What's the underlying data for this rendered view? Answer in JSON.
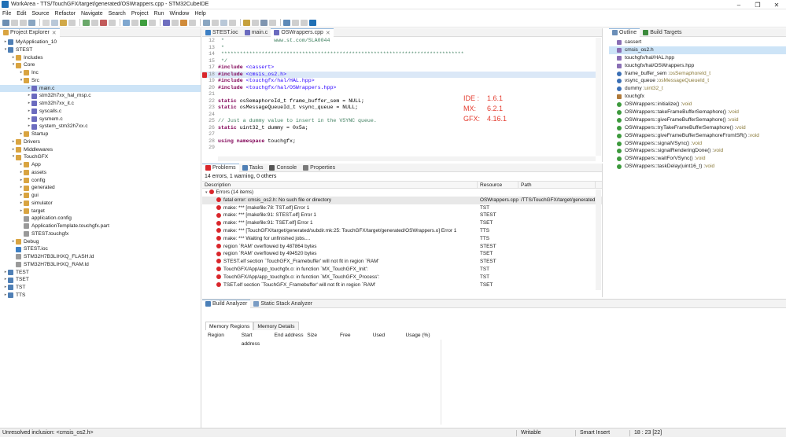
{
  "window": {
    "title": "WorkArea - TTS/TouchGFX/target/generated/OSWrappers.cpp - STM32CubeIDE"
  },
  "menu": [
    "File",
    "Edit",
    "Source",
    "Refactor",
    "Navigate",
    "Search",
    "Project",
    "Run",
    "Window",
    "Help"
  ],
  "explorer": {
    "tab": "Project Explorer",
    "tree": [
      {
        "label": "MyApplication_10",
        "depth": 0,
        "arrow": "▸",
        "icon": "project"
      },
      {
        "label": "STEST",
        "depth": 0,
        "arrow": "▾",
        "icon": "project"
      },
      {
        "label": "Includes",
        "depth": 1,
        "arrow": "▸",
        "icon": "folder"
      },
      {
        "label": "Core",
        "depth": 1,
        "arrow": "▾",
        "icon": "folder"
      },
      {
        "label": "Inc",
        "depth": 2,
        "arrow": "▸",
        "icon": "folder"
      },
      {
        "label": "Src",
        "depth": 2,
        "arrow": "▾",
        "icon": "folder"
      },
      {
        "label": "main.c",
        "depth": 3,
        "arrow": "▸",
        "icon": "cfile",
        "selected": true
      },
      {
        "label": "stm32h7xx_hal_msp.c",
        "depth": 3,
        "arrow": "▸",
        "icon": "cfile"
      },
      {
        "label": "stm32h7xx_it.c",
        "depth": 3,
        "arrow": "▸",
        "icon": "cfile"
      },
      {
        "label": "syscalls.c",
        "depth": 3,
        "arrow": "▸",
        "icon": "cfile"
      },
      {
        "label": "sysmem.c",
        "depth": 3,
        "arrow": "▸",
        "icon": "cfile"
      },
      {
        "label": "system_stm32h7xx.c",
        "depth": 3,
        "arrow": "▸",
        "icon": "cfile"
      },
      {
        "label": "Startup",
        "depth": 2,
        "arrow": "▸",
        "icon": "folder"
      },
      {
        "label": "Drivers",
        "depth": 1,
        "arrow": "▸",
        "icon": "folder"
      },
      {
        "label": "Middlewares",
        "depth": 1,
        "arrow": "▸",
        "icon": "folder"
      },
      {
        "label": "TouchGFX",
        "depth": 1,
        "arrow": "▾",
        "icon": "folder"
      },
      {
        "label": "App",
        "depth": 2,
        "arrow": "▸",
        "icon": "folder"
      },
      {
        "label": "assets",
        "depth": 2,
        "arrow": "▸",
        "icon": "folder"
      },
      {
        "label": "config",
        "depth": 2,
        "arrow": "▸",
        "icon": "folder"
      },
      {
        "label": "generated",
        "depth": 2,
        "arrow": "▸",
        "icon": "folder"
      },
      {
        "label": "gui",
        "depth": 2,
        "arrow": "▸",
        "icon": "folder"
      },
      {
        "label": "simulator",
        "depth": 2,
        "arrow": "▸",
        "icon": "folder"
      },
      {
        "label": "target",
        "depth": 2,
        "arrow": "▸",
        "icon": "folder"
      },
      {
        "label": "application.config",
        "depth": 2,
        "arrow": "",
        "icon": "file"
      },
      {
        "label": "ApplicationTemplate.touchgfx.part",
        "depth": 2,
        "arrow": "",
        "icon": "file"
      },
      {
        "label": "STEST.touchgfx",
        "depth": 2,
        "arrow": "",
        "icon": "file"
      },
      {
        "label": "Debug",
        "depth": 1,
        "arrow": "▸",
        "icon": "folder"
      },
      {
        "label": "STEST.ioc",
        "depth": 1,
        "arrow": "",
        "icon": "ioc"
      },
      {
        "label": "STM32H7B3LIHXQ_FLASH.ld",
        "depth": 1,
        "arrow": "",
        "icon": "file"
      },
      {
        "label": "STM32H7B3LIHXQ_RAM.ld",
        "depth": 1,
        "arrow": "",
        "icon": "file"
      },
      {
        "label": "TEST",
        "depth": 0,
        "arrow": "▸",
        "icon": "project"
      },
      {
        "label": "TSET",
        "depth": 0,
        "arrow": "▸",
        "icon": "project"
      },
      {
        "label": "TST",
        "depth": 0,
        "arrow": "▸",
        "icon": "project"
      },
      {
        "label": "TTS",
        "depth": 0,
        "arrow": "▸",
        "icon": "project"
      }
    ]
  },
  "editor": {
    "tabs": [
      {
        "label": "STEST.ioc",
        "active": false
      },
      {
        "label": "main.c",
        "active": false
      },
      {
        "label": "OSWrappers.cpp",
        "active": true
      }
    ],
    "lines": [
      {
        "n": "12",
        "parts": [
          {
            "t": " *                www.st.com/SLA0044",
            "c": "cm"
          }
        ]
      },
      {
        "n": "13",
        "parts": [
          {
            "t": " *",
            "c": "cm"
          }
        ]
      },
      {
        "n": "14",
        "parts": [
          {
            "t": " ******************************************************************************",
            "c": "cm"
          }
        ]
      },
      {
        "n": "15",
        "parts": [
          {
            "t": " */",
            "c": "cm"
          }
        ]
      },
      {
        "n": "17",
        "parts": [
          {
            "t": "#include ",
            "c": "kw"
          },
          {
            "t": "<cassert>",
            "c": "inc"
          }
        ]
      },
      {
        "n": "18",
        "hl": true,
        "parts": [
          {
            "t": "#include ",
            "c": "kw"
          },
          {
            "t": "<cmsis_os2.h>",
            "c": "inc"
          }
        ]
      },
      {
        "n": "19",
        "parts": [
          {
            "t": "#include ",
            "c": "kw"
          },
          {
            "t": "<touchgfx/hal/HAL.hpp>",
            "c": "inc"
          }
        ]
      },
      {
        "n": "20",
        "parts": [
          {
            "t": "#include ",
            "c": "kw"
          },
          {
            "t": "<touchgfx/hal/OSWrappers.hpp>",
            "c": "inc"
          }
        ]
      },
      {
        "n": "21",
        "parts": [
          {
            "t": "",
            "c": ""
          }
        ]
      },
      {
        "n": "22",
        "parts": [
          {
            "t": "static ",
            "c": "kw"
          },
          {
            "t": "osSemaphoreId_t frame_buffer_sem = NULL;",
            "c": ""
          }
        ]
      },
      {
        "n": "23",
        "parts": [
          {
            "t": "static ",
            "c": "kw"
          },
          {
            "t": "osMessageQueueId_t vsync_queue = NULL;",
            "c": ""
          }
        ]
      },
      {
        "n": "24",
        "parts": [
          {
            "t": "",
            "c": ""
          }
        ]
      },
      {
        "n": "25",
        "parts": [
          {
            "t": "// Just a dummy value to insert in the VSYNC queue.",
            "c": "cm"
          }
        ]
      },
      {
        "n": "26",
        "parts": [
          {
            "t": "static ",
            "c": "kw"
          },
          {
            "t": "uint32_t dummy = 0x5a;",
            "c": ""
          }
        ]
      },
      {
        "n": "27",
        "parts": [
          {
            "t": "",
            "c": ""
          }
        ]
      },
      {
        "n": "28",
        "parts": [
          {
            "t": "using namespace ",
            "c": "kw"
          },
          {
            "t": "touchgfx;",
            "c": ""
          }
        ]
      },
      {
        "n": "29",
        "parts": [
          {
            "t": "",
            "c": ""
          }
        ]
      }
    ],
    "versions": [
      {
        "k": "IDE :",
        "v": "1.6.1"
      },
      {
        "k": "MX:",
        "v": "6.2.1"
      },
      {
        "k": "GFX:",
        "v": "4.16.1"
      }
    ]
  },
  "problems": {
    "tabs": [
      "Problems",
      "Tasks",
      "Console",
      "Properties"
    ],
    "summary": "14 errors, 1 warning, 0 others",
    "columns": [
      "Description",
      "Resource",
      "Path"
    ],
    "group": "Errors (14 items)",
    "rows": [
      {
        "d": "fatal error: cmsis_os2.h: No such file or directory",
        "r": "OSWrappers.cpp",
        "p": "/TTS/TouchGFX/target/generated",
        "selected": true
      },
      {
        "d": "make: *** [makefile:78: TST.elf] Error 1",
        "r": "TST",
        "p": ""
      },
      {
        "d": "make: *** [makefile:91: STEST.elf] Error 1",
        "r": "STEST",
        "p": ""
      },
      {
        "d": "make: *** [makefile:91: TSET.elf] Error 1",
        "r": "TSET",
        "p": ""
      },
      {
        "d": "make: *** [TouchGFX/target/generated/subdir.mk:25: TouchGFX/target/generated/OSWrappers.o] Error 1",
        "r": "TTS",
        "p": ""
      },
      {
        "d": "make: *** Waiting for unfinished jobs....",
        "r": "TTS",
        "p": ""
      },
      {
        "d": "region `RAM' overflowed by 487864 bytes",
        "r": "STEST",
        "p": ""
      },
      {
        "d": "region `RAM' overflowed by 494520 bytes",
        "r": "TSET",
        "p": ""
      },
      {
        "d": "STEST.elf section `TouchGFX_Framebuffer' will not fit in region `RAM'",
        "r": "STEST",
        "p": ""
      },
      {
        "d": "TouchGFX/App/app_touchgfx.o: in function `MX_TouchGFX_Init':",
        "r": "TST",
        "p": ""
      },
      {
        "d": "TouchGFX/App/app_touchgfx.o: in function `MX_TouchGFX_Process':",
        "r": "TST",
        "p": ""
      },
      {
        "d": "TSET.elf section `TouchGFX_Framebuffer' will not fit in region `RAM'",
        "r": "TSET",
        "p": ""
      }
    ]
  },
  "outline": {
    "tabs": [
      "Outline",
      "Build Targets"
    ],
    "items": [
      {
        "label": "cassert",
        "ret": "",
        "icon": "include"
      },
      {
        "label": "cmsis_os2.h",
        "ret": "",
        "icon": "include",
        "selected": true
      },
      {
        "label": "touchgfx/hal/HAL.hpp",
        "ret": "",
        "icon": "include"
      },
      {
        "label": "touchgfx/hal/OSWrappers.hpp",
        "ret": "",
        "icon": "include"
      },
      {
        "label": "frame_buffer_sem : ",
        "ret": "osSemaphoreId_t",
        "icon": "var"
      },
      {
        "label": "vsync_queue : ",
        "ret": "osMessageQueueId_t",
        "icon": "var"
      },
      {
        "label": "dummy : ",
        "ret": "uint32_t",
        "icon": "var"
      },
      {
        "label": "touchgfx",
        "ret": "",
        "icon": "ns"
      },
      {
        "label": "OSWrappers::initialize() : ",
        "ret": "void",
        "icon": "fn"
      },
      {
        "label": "OSWrappers::takeFrameBufferSemaphore() : ",
        "ret": "void",
        "icon": "fn"
      },
      {
        "label": "OSWrappers::giveFrameBufferSemaphore() : ",
        "ret": "void",
        "icon": "fn"
      },
      {
        "label": "OSWrappers::tryTakeFrameBufferSemaphore() : ",
        "ret": "void",
        "icon": "fn"
      },
      {
        "label": "OSWrappers::giveFrameBufferSemaphoreFromISR() : ",
        "ret": "void",
        "icon": "fn"
      },
      {
        "label": "OSWrappers::signalVSync() : ",
        "ret": "void",
        "icon": "fn"
      },
      {
        "label": "OSWrappers::signalRenderingDone() : ",
        "ret": "void",
        "icon": "fn"
      },
      {
        "label": "OSWrappers::waitForVSync() : ",
        "ret": "void",
        "icon": "fn"
      },
      {
        "label": "OSWrappers::taskDelay(uint16_t) : ",
        "ret": "void",
        "icon": "fn"
      }
    ]
  },
  "analyzer": {
    "tabs": [
      "Build Analyzer",
      "Static Stack Analyzer"
    ],
    "subtabs": [
      "Memory Regions",
      "Memory Details"
    ],
    "columns": [
      "Region",
      "Start address",
      "End address",
      "Size",
      "Free",
      "Used",
      "Usage (%)"
    ]
  },
  "status": {
    "message": "Unresolved inclusion: <cmsis_os2.h>",
    "mode": "Writable",
    "insert": "Smart Insert",
    "position": "18 : 23 [22]"
  },
  "colors": {
    "accent": "#1f6fb5",
    "error": "#d9262b",
    "annotation": "#e43c2f",
    "selection": "#cde4f7"
  }
}
